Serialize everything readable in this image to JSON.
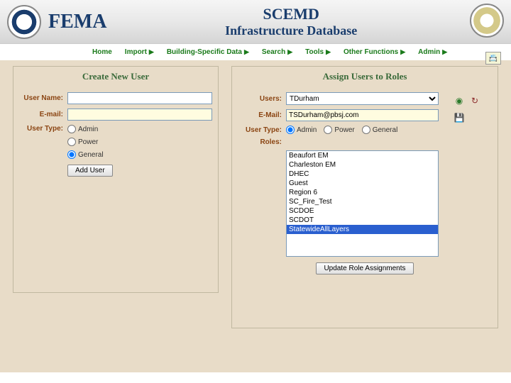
{
  "header": {
    "agency": "FEMA",
    "title1": "SCEMD",
    "title2": "Infrastructure Database"
  },
  "nav": [
    "Home",
    "Import",
    "Building-Specific Data",
    "Search",
    "Tools",
    "Other Functions",
    "Admin"
  ],
  "createUser": {
    "title": "Create New User",
    "labels": {
      "username": "User Name:",
      "email": "E-mail:",
      "usertype": "User Type:"
    },
    "values": {
      "username": "",
      "email": ""
    },
    "types": [
      "Admin",
      "Power",
      "General"
    ],
    "selectedType": "General",
    "addBtn": "Add User"
  },
  "assignRoles": {
    "title": "Assign Users to Roles",
    "labels": {
      "users": "Users:",
      "email": "E-Mail:",
      "usertype": "User Type:",
      "roles": "Roles:"
    },
    "selectedUser": "TDurham",
    "email": "TSDurham@pbsj.com",
    "types": [
      "Admin",
      "Power",
      "General"
    ],
    "selectedType": "Admin",
    "roles": [
      "Beaufort EM",
      "Charleston EM",
      "DHEC",
      "Guest",
      "Region 6",
      "SC_Fire_Test",
      "SCDOE",
      "SCDOT",
      "StatewideAllLayers"
    ],
    "selectedRole": "StatewideAllLayers",
    "updateBtn": "Update Role Assignments"
  }
}
